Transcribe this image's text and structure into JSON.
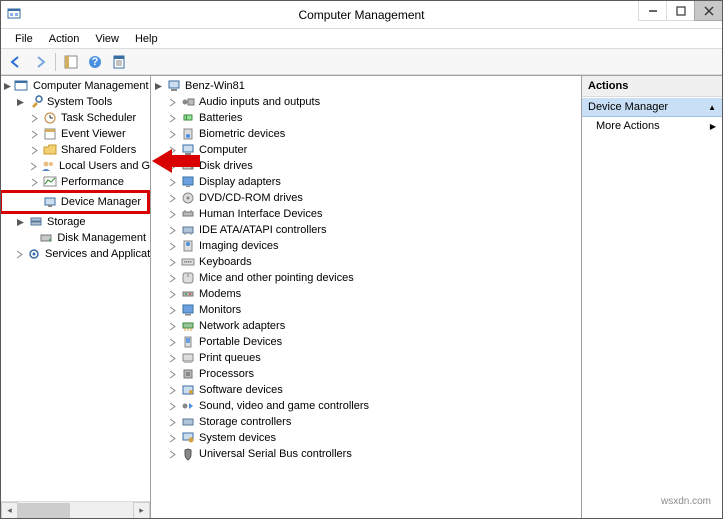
{
  "window": {
    "title": "Computer Management"
  },
  "menu": {
    "file": "File",
    "action": "Action",
    "view": "View",
    "help": "Help"
  },
  "leftTree": {
    "root": "Computer Management (Local",
    "sysTools": "System Tools",
    "taskScheduler": "Task Scheduler",
    "eventViewer": "Event Viewer",
    "sharedFolders": "Shared Folders",
    "localUsers": "Local Users and Groups",
    "performance": "Performance",
    "deviceManager": "Device Manager",
    "storage": "Storage",
    "diskManagement": "Disk Management",
    "servicesApps": "Services and Applications"
  },
  "midTree": {
    "root": "Benz-Win81",
    "items": [
      "Audio inputs and outputs",
      "Batteries",
      "Biometric devices",
      "Computer",
      "Disk drives",
      "Display adapters",
      "DVD/CD-ROM drives",
      "Human Interface Devices",
      "IDE ATA/ATAPI controllers",
      "Imaging devices",
      "Keyboards",
      "Mice and other pointing devices",
      "Modems",
      "Monitors",
      "Network adapters",
      "Portable Devices",
      "Print queues",
      "Processors",
      "Software devices",
      "Sound, video and game controllers",
      "Storage controllers",
      "System devices",
      "Universal Serial Bus controllers"
    ]
  },
  "actions": {
    "header": "Actions",
    "selected": "Device Manager",
    "more": "More Actions"
  },
  "watermark": "wsxdn.com"
}
